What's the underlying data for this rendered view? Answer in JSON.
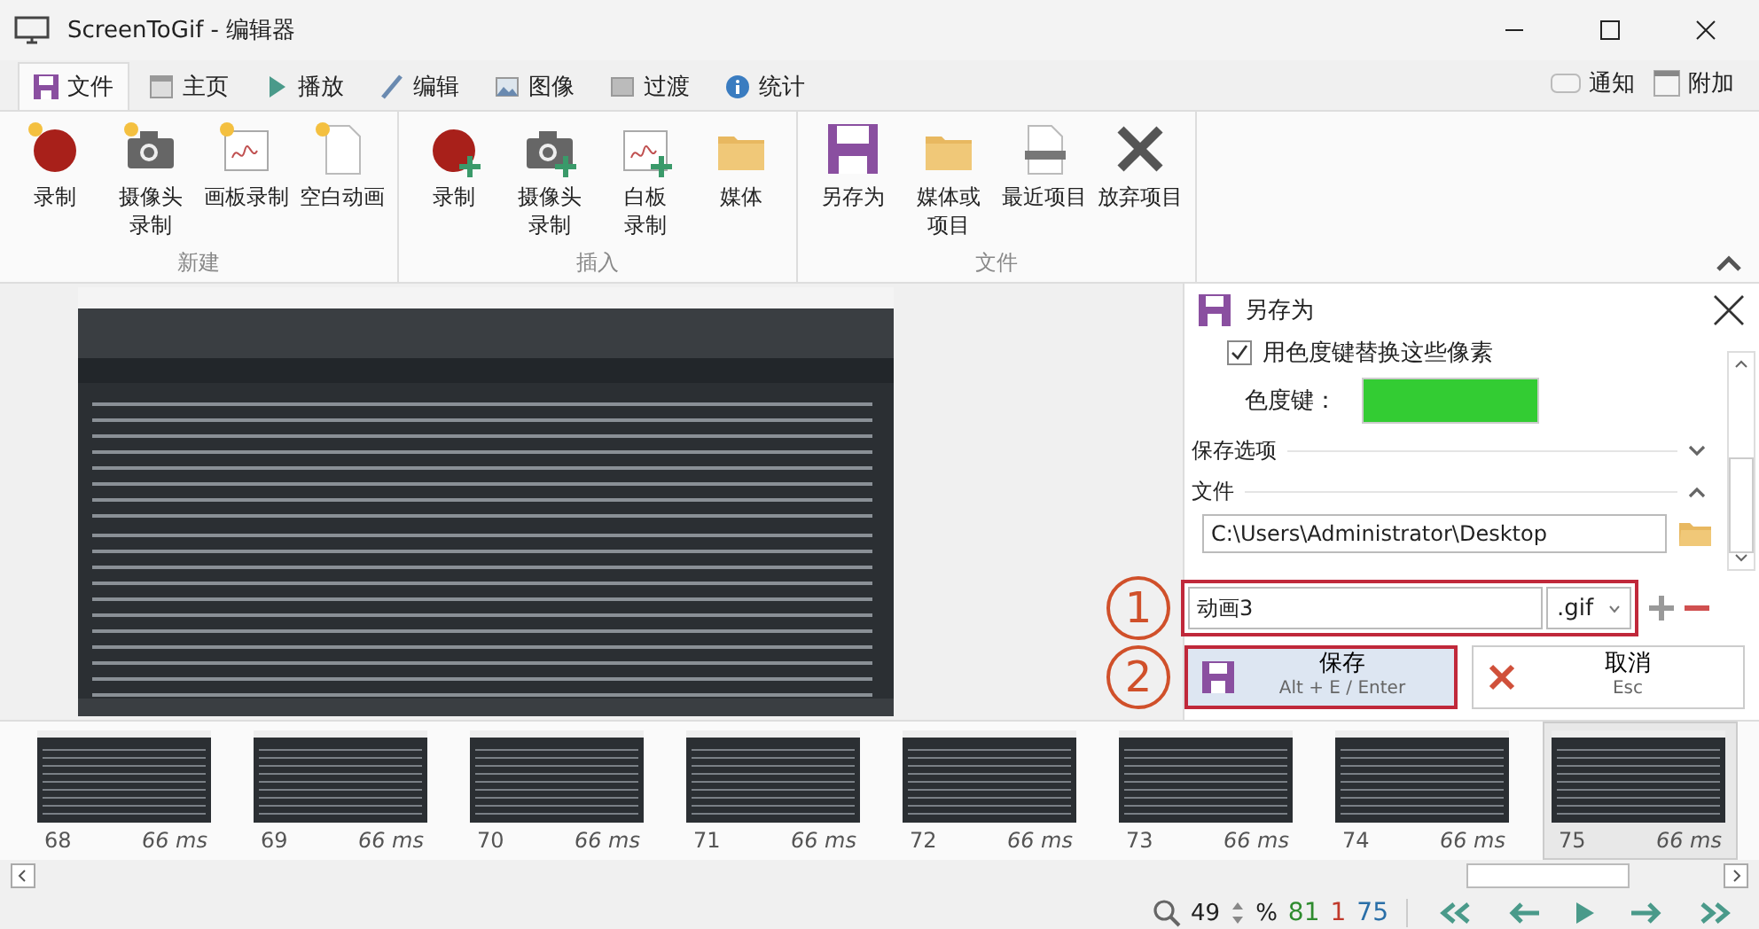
{
  "window": {
    "title": "ScreenToGif - 编辑器"
  },
  "tabs": [
    {
      "label": "文件",
      "kind": "save",
      "selected": true
    },
    {
      "label": "主页",
      "kind": "home",
      "selected": false
    },
    {
      "label": "播放",
      "kind": "play",
      "selected": false
    },
    {
      "label": "编辑",
      "kind": "pen",
      "selected": false
    },
    {
      "label": "图像",
      "kind": "image",
      "selected": false
    },
    {
      "label": "过渡",
      "kind": "transition",
      "selected": false
    },
    {
      "label": "统计",
      "kind": "info",
      "selected": false
    }
  ],
  "top_links": [
    {
      "label": "通知",
      "kind": "tag"
    },
    {
      "label": "附加",
      "kind": "window"
    }
  ],
  "ribbon_groups": [
    {
      "title": "新建",
      "items": [
        {
          "lines": [
            "录制"
          ],
          "kind": "record"
        },
        {
          "lines": [
            "摄像头",
            "录制"
          ],
          "kind": "camera"
        },
        {
          "lines": [
            "画板录制"
          ],
          "kind": "board"
        },
        {
          "lines": [
            "空白动画"
          ],
          "kind": "blank"
        }
      ]
    },
    {
      "title": "插入",
      "items": [
        {
          "lines": [
            "录制"
          ],
          "kind": "record-add"
        },
        {
          "lines": [
            "摄像头",
            "录制"
          ],
          "kind": "camera-add"
        },
        {
          "lines": [
            "白板",
            "录制"
          ],
          "kind": "board-add"
        },
        {
          "lines": [
            "媒体"
          ],
          "kind": "folder"
        }
      ]
    },
    {
      "title": "文件",
      "items": [
        {
          "lines": [
            "另存为"
          ],
          "kind": "save"
        },
        {
          "lines": [
            "媒体或",
            "项目"
          ],
          "kind": "folder"
        },
        {
          "lines": [
            "最近项目"
          ],
          "kind": "file"
        },
        {
          "lines": [
            "放弃项目"
          ],
          "kind": "discard"
        }
      ]
    }
  ],
  "save_panel": {
    "title": "另存为",
    "checkbox": {
      "label": "用色度键替换这些像素",
      "checked": true
    },
    "chroma_key": {
      "label": "色度键：",
      "color": "#33cc33"
    },
    "sections": [
      {
        "label": "保存选项",
        "expanded": false
      },
      {
        "label": "文件",
        "expanded": true
      }
    ],
    "folder_path": "C:\\Users\\Administrator\\Desktop",
    "filename": {
      "marker": "1",
      "value": "动画3",
      "extension": ".gif"
    },
    "save_button": {
      "marker": "2",
      "label": "保存",
      "shortcut": "Alt + E / Enter"
    },
    "cancel_button": {
      "label": "取消",
      "shortcut": "Esc"
    }
  },
  "frames": [
    {
      "number": "68",
      "delay": "66 ms",
      "selected": false
    },
    {
      "number": "69",
      "delay": "66 ms",
      "selected": false
    },
    {
      "number": "70",
      "delay": "66 ms",
      "selected": false
    },
    {
      "number": "71",
      "delay": "66 ms",
      "selected": false
    },
    {
      "number": "72",
      "delay": "66 ms",
      "selected": false
    },
    {
      "number": "73",
      "delay": "66 ms",
      "selected": false
    },
    {
      "number": "74",
      "delay": "66 ms",
      "selected": false
    },
    {
      "number": "75",
      "delay": "66 ms",
      "selected": true
    }
  ],
  "status_bar": {
    "zoom": "49",
    "zoom_unit": "%",
    "counts": [
      {
        "value": "81",
        "color": "#2e8b2e"
      },
      {
        "value": "1",
        "color": "#c0392b"
      },
      {
        "value": "75",
        "color": "#2a6fa8"
      }
    ]
  }
}
